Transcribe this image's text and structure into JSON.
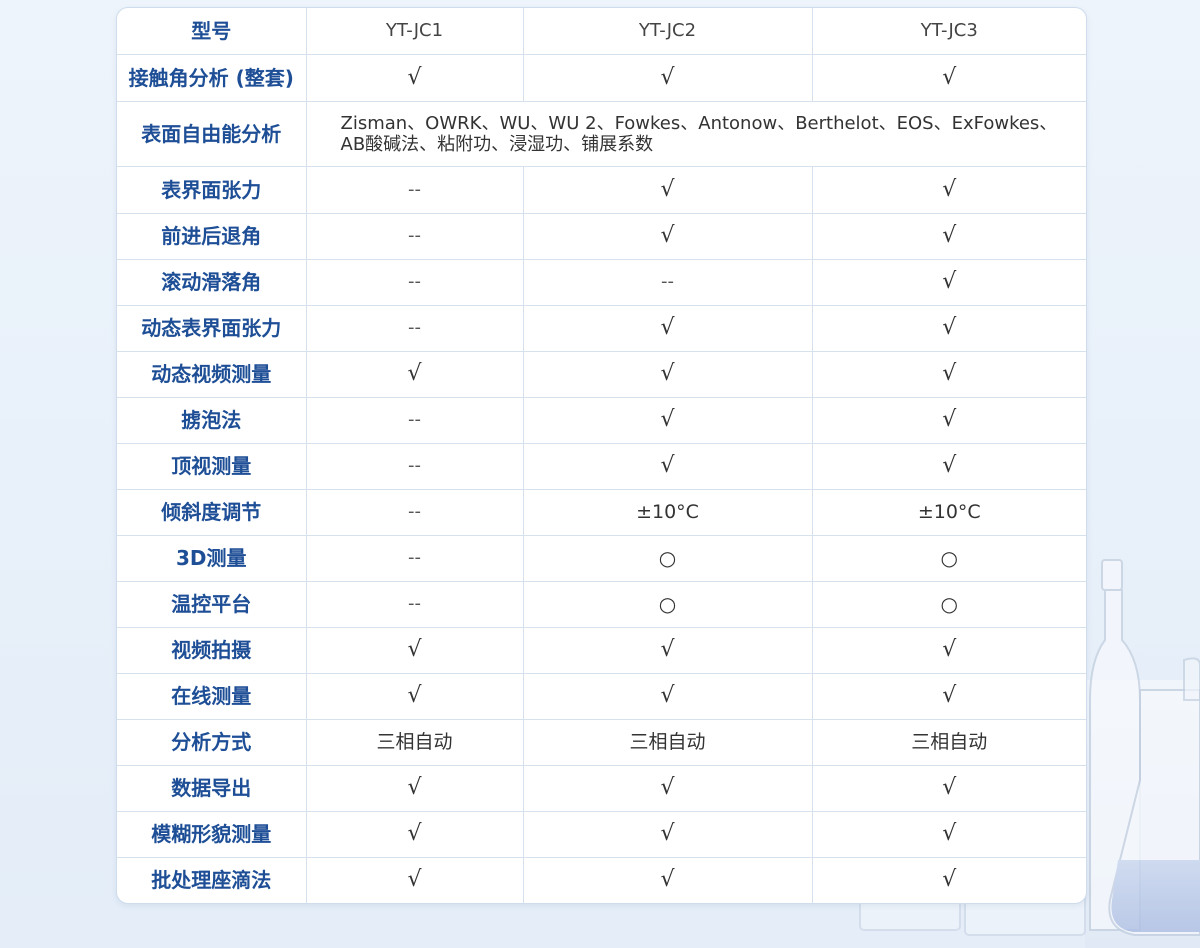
{
  "table": {
    "columns": [
      "型号",
      "YT-JC1",
      "YT-JC2",
      "YT-JC3"
    ],
    "rows": [
      {
        "label": "接触角分析 (整套)",
        "cells": [
          "√",
          "√",
          "√"
        ]
      },
      {
        "label": "表面自由能分析",
        "span_text": "Zisman、OWRK、WU、WU 2、Fowkes、Antonow、Berthelot、EOS、ExFowkes、AB酸碱法、粘附功、浸湿功、铺展系数"
      },
      {
        "label": "表界面张力",
        "cells": [
          "--",
          "√",
          "√"
        ]
      },
      {
        "label": "前进后退角",
        "cells": [
          "--",
          "√",
          "√"
        ]
      },
      {
        "label": "滚动滑落角",
        "cells": [
          "--",
          "--",
          "√"
        ]
      },
      {
        "label": "动态表界面张力",
        "cells": [
          "--",
          "√",
          "√"
        ]
      },
      {
        "label": "动态视频测量",
        "cells": [
          "√",
          "√",
          "√"
        ]
      },
      {
        "label": "掳泡法",
        "cells": [
          "--",
          "√",
          "√"
        ]
      },
      {
        "label": "顶视测量",
        "cells": [
          "--",
          "√",
          "√"
        ]
      },
      {
        "label": "倾斜度调节",
        "cells": [
          "--",
          "±10°C",
          "±10°C"
        ]
      },
      {
        "label": "3D测量",
        "cells": [
          "--",
          "○",
          "○"
        ]
      },
      {
        "label": "温控平台",
        "cells": [
          "--",
          "○",
          "○"
        ]
      },
      {
        "label": "视频拍摄",
        "cells": [
          "√",
          "√",
          "√"
        ]
      },
      {
        "label": "在线测量",
        "cells": [
          "√",
          "√",
          "√"
        ]
      },
      {
        "label": "分析方式",
        "cells": [
          "三相自动",
          "三相自动",
          "三相自动"
        ]
      },
      {
        "label": "数据导出",
        "cells": [
          "√",
          "√",
          "√"
        ]
      },
      {
        "label": "模糊形貌测量",
        "cells": [
          "√",
          "√",
          "√"
        ]
      },
      {
        "label": "批处理座滴法",
        "cells": [
          "√",
          "√",
          "√"
        ]
      }
    ]
  },
  "colors": {
    "label_text": "#1e4f96",
    "border": "#d6e1ee",
    "background": "#eef4fb"
  }
}
